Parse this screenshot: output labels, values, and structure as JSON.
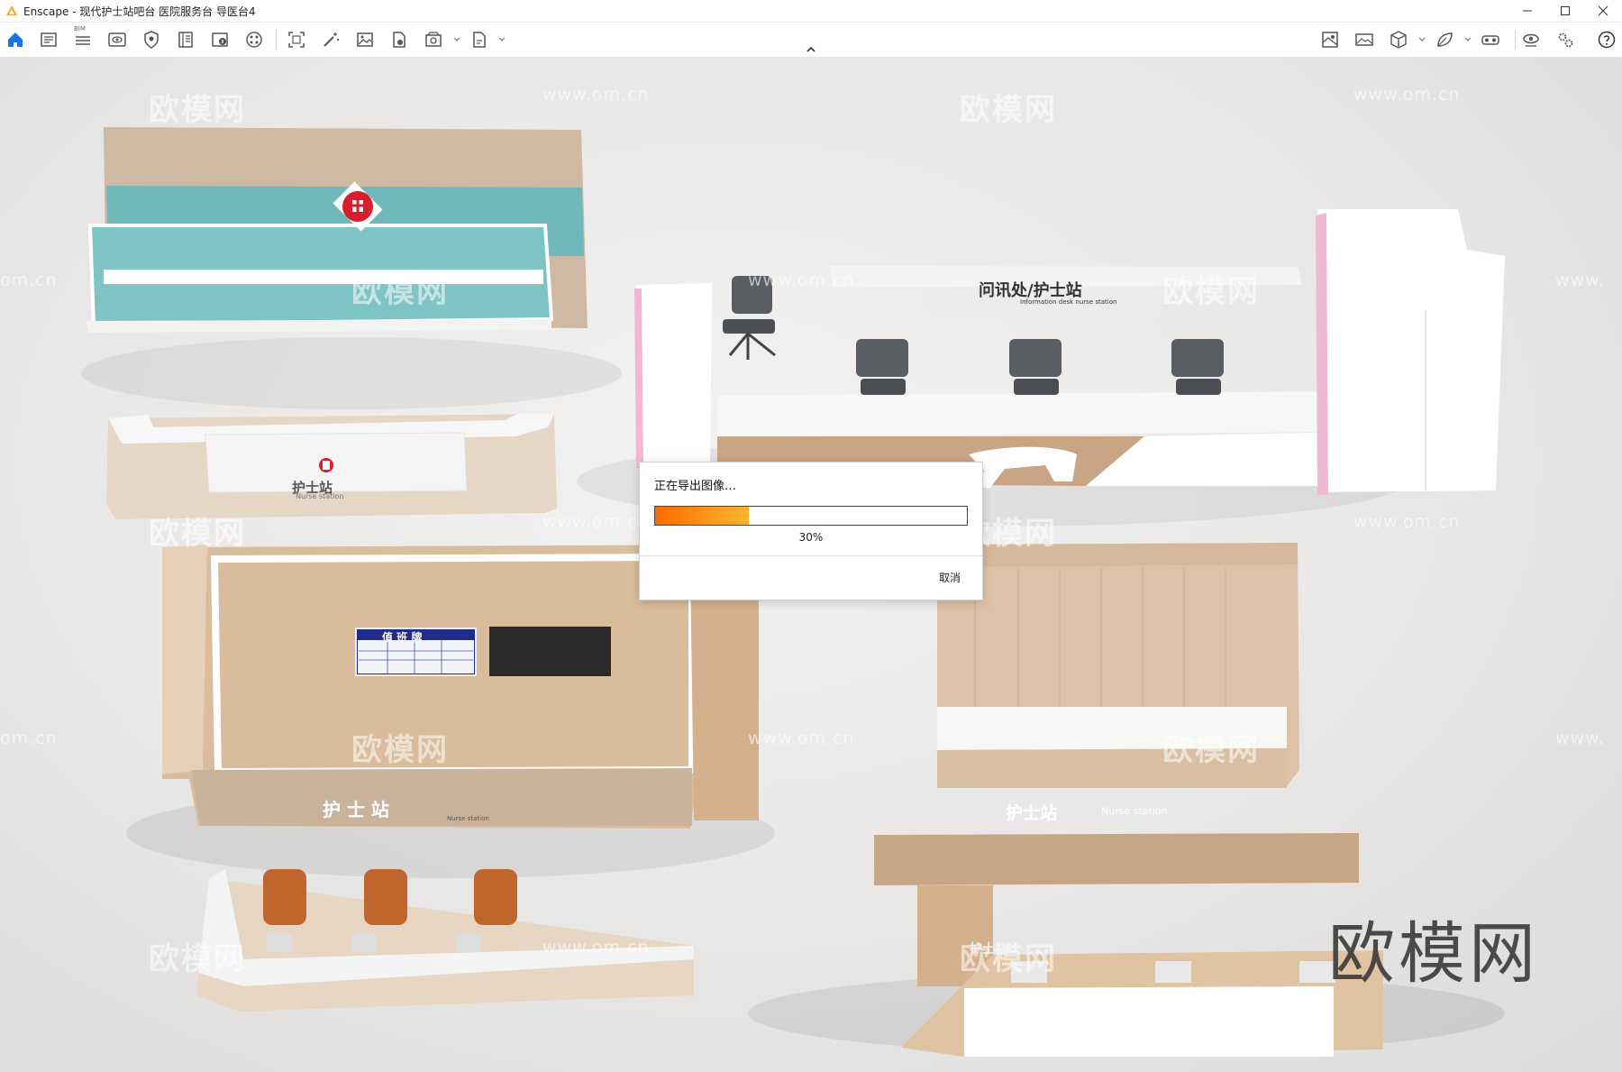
{
  "window": {
    "title": "Enscape - 现代护士站吧台 医院服务台 导医台4",
    "logo_icon": "enscape-logo-icon",
    "controls": [
      "minimize-icon",
      "maximize-icon",
      "close-icon"
    ]
  },
  "toolbar": {
    "bim_label": "BIM",
    "left_icons": [
      "home-icon",
      "document-icon",
      "bim-list-icon",
      "eye-icon",
      "shield-icon",
      "book-icon",
      "info-book-icon",
      "palette-icon",
      "frame-icon",
      "magic-wand-icon",
      "image-icon",
      "file-export-icon",
      "batch-render-icon",
      "exe-export-icon"
    ],
    "right_icons": [
      "asset-library-icon",
      "panorama-icon",
      "cube-icon",
      "leaf-icon",
      "vr-headset-icon",
      "visual-settings-icon",
      "settings-gear-icon",
      "help-icon"
    ]
  },
  "viewport": {
    "watermark_text": "欧模网",
    "watermark_url": "www.om.cn",
    "partial_watermark_left": "om.cn",
    "partial_watermark_right": "www.",
    "brand_watermark": "欧模网",
    "signs": {
      "nurse_cn": "护士站",
      "nurse_cn_spaced": "护 士 站",
      "nurse_en": "Nurse station",
      "nurse_en_spaced": "Nurse   station",
      "info_desk_cn": "问讯处/护士站",
      "info_desk_en": "Information desk nurse station",
      "duty_board": "值 班 牌"
    }
  },
  "export_dialog": {
    "title": "正在导出图像…",
    "progress_percent": 30,
    "progress_label": "30%",
    "cancel_label": "取消"
  },
  "colors": {
    "accent_blue": "#1a73e8",
    "teal": "#6fb8ba",
    "wood": "#d8bfa3",
    "progress_orange": "#ff8a00"
  }
}
